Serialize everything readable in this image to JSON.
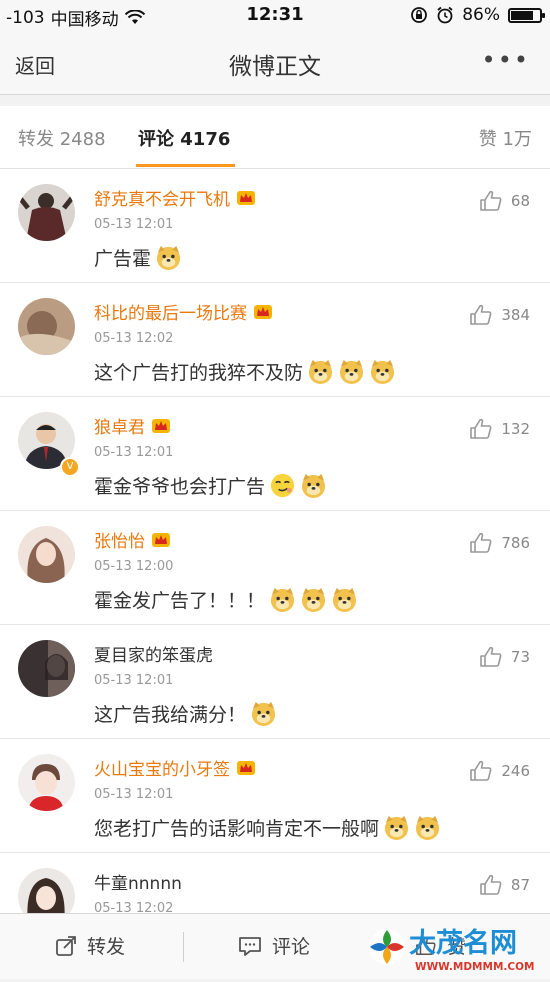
{
  "status_bar": {
    "signal": "-103",
    "carrier": "中国移动",
    "time": "12:31",
    "battery": "86%",
    "battery_level": 0.86
  },
  "nav": {
    "back": "返回",
    "title": "微博正文",
    "more": "•••"
  },
  "tabs": [
    {
      "label": "转发 2488"
    },
    {
      "label": "评论 4176"
    },
    {
      "label": "赞 1万"
    }
  ],
  "comments": [
    {
      "name": "舒克真不会开飞机",
      "time": "05-13 12:01",
      "text": "广告霍",
      "likes": "68",
      "emoji": [
        "doge"
      ]
    },
    {
      "name": "科比的最后一场比赛",
      "time": "05-13 12:02",
      "text": "这个广告打的我猝不及防",
      "likes": "384",
      "emoji": [
        "doge",
        "doge",
        "doge"
      ]
    },
    {
      "name": "狼卓君",
      "time": "05-13 12:01",
      "text": "霍金爷爷也会打广告",
      "likes": "132",
      "emoji": [
        "smile",
        "doge"
      ]
    },
    {
      "name": "张怡怡",
      "time": "05-13 12:00",
      "text": "霍金发广告了！！！",
      "likes": "786",
      "emoji": [
        "doge",
        "doge",
        "doge"
      ]
    },
    {
      "name": "夏目家的笨蛋虎",
      "time": "05-13 12:01",
      "text": "这广告我给满分！",
      "likes": "73",
      "emoji": [
        "doge"
      ]
    },
    {
      "name": "火山宝宝的小牙签",
      "time": "05-13 12:01",
      "text": "您老打广告的话影响肯定不一般啊",
      "likes": "246",
      "emoji": [
        "doge",
        "doge"
      ]
    },
    {
      "name": "牛童nnnnn",
      "time": "05-13 12:02",
      "text": "",
      "likes": "87",
      "emoji": []
    }
  ],
  "bottom_bar": {
    "repost": "转发",
    "comment": "评论",
    "like": "赞"
  },
  "watermark": {
    "title": "大茂名网",
    "url": "WWW.MDMMM.COM"
  },
  "colors": {
    "accent": "#f8991f",
    "username": "#e8790f"
  }
}
